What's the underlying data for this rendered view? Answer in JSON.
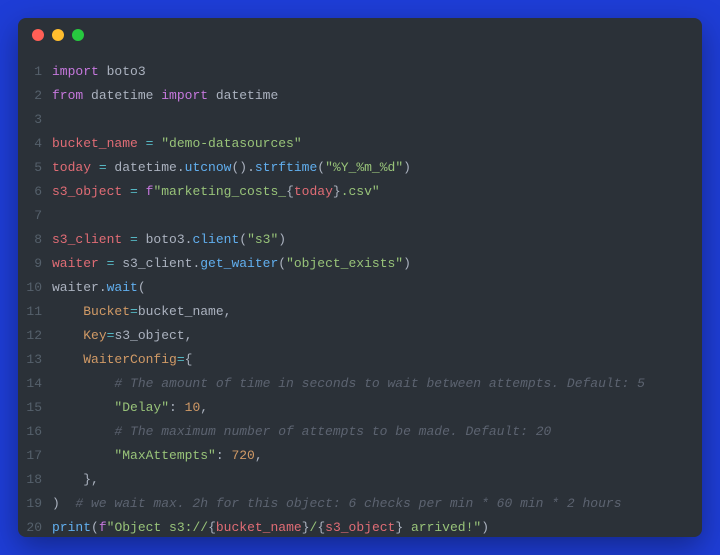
{
  "titlebar": {
    "dots": [
      "red",
      "yellow",
      "green"
    ]
  },
  "colors": {
    "background": "#1e3dd6",
    "editor_bg": "#2b3138",
    "gutter": "#55606b",
    "keyword": "#c678dd",
    "ident": "#e06c75",
    "func": "#61afef",
    "string": "#98c379",
    "number": "#d19a66",
    "operator": "#56b6c2",
    "default": "#abb2bf",
    "comment": "#5c6370"
  },
  "code": {
    "lines": [
      {
        "n": 1,
        "tokens": [
          {
            "t": "import ",
            "c": "kw"
          },
          {
            "t": "boto3",
            "c": "default"
          }
        ]
      },
      {
        "n": 2,
        "tokens": [
          {
            "t": "from ",
            "c": "kw"
          },
          {
            "t": "datetime ",
            "c": "default"
          },
          {
            "t": "import ",
            "c": "kw"
          },
          {
            "t": "datetime",
            "c": "default"
          }
        ]
      },
      {
        "n": 3,
        "tokens": []
      },
      {
        "n": 4,
        "tokens": [
          {
            "t": "bucket_name ",
            "c": "id"
          },
          {
            "t": "= ",
            "c": "op"
          },
          {
            "t": "\"demo-datasources\"",
            "c": "str"
          }
        ]
      },
      {
        "n": 5,
        "tokens": [
          {
            "t": "today ",
            "c": "id"
          },
          {
            "t": "= ",
            "c": "op"
          },
          {
            "t": "datetime",
            "c": "default"
          },
          {
            "t": ".",
            "c": "punc"
          },
          {
            "t": "utcnow",
            "c": "fn"
          },
          {
            "t": "().",
            "c": "punc"
          },
          {
            "t": "strftime",
            "c": "fn"
          },
          {
            "t": "(",
            "c": "punc"
          },
          {
            "t": "\"%Y_%m_%d\"",
            "c": "str"
          },
          {
            "t": ")",
            "c": "punc"
          }
        ]
      },
      {
        "n": 6,
        "tokens": [
          {
            "t": "s3_object ",
            "c": "id"
          },
          {
            "t": "= ",
            "c": "op"
          },
          {
            "t": "f",
            "c": "kw"
          },
          {
            "t": "\"marketing_costs_",
            "c": "str"
          },
          {
            "t": "{",
            "c": "punc"
          },
          {
            "t": "today",
            "c": "id"
          },
          {
            "t": "}",
            "c": "punc"
          },
          {
            "t": ".csv\"",
            "c": "str"
          }
        ]
      },
      {
        "n": 7,
        "tokens": []
      },
      {
        "n": 8,
        "tokens": [
          {
            "t": "s3_client ",
            "c": "id"
          },
          {
            "t": "= ",
            "c": "op"
          },
          {
            "t": "boto3",
            "c": "default"
          },
          {
            "t": ".",
            "c": "punc"
          },
          {
            "t": "client",
            "c": "fn"
          },
          {
            "t": "(",
            "c": "punc"
          },
          {
            "t": "\"s3\"",
            "c": "str"
          },
          {
            "t": ")",
            "c": "punc"
          }
        ]
      },
      {
        "n": 9,
        "tokens": [
          {
            "t": "waiter ",
            "c": "id"
          },
          {
            "t": "= ",
            "c": "op"
          },
          {
            "t": "s3_client",
            "c": "default"
          },
          {
            "t": ".",
            "c": "punc"
          },
          {
            "t": "get_waiter",
            "c": "fn"
          },
          {
            "t": "(",
            "c": "punc"
          },
          {
            "t": "\"object_exists\"",
            "c": "str"
          },
          {
            "t": ")",
            "c": "punc"
          }
        ]
      },
      {
        "n": 10,
        "tokens": [
          {
            "t": "waiter",
            "c": "default"
          },
          {
            "t": ".",
            "c": "punc"
          },
          {
            "t": "wait",
            "c": "fn"
          },
          {
            "t": "(",
            "c": "punc"
          }
        ]
      },
      {
        "n": 11,
        "tokens": [
          {
            "t": "    ",
            "c": "default"
          },
          {
            "t": "Bucket",
            "c": "prop"
          },
          {
            "t": "=",
            "c": "op"
          },
          {
            "t": "bucket_name",
            "c": "default"
          },
          {
            "t": ",",
            "c": "punc"
          }
        ]
      },
      {
        "n": 12,
        "tokens": [
          {
            "t": "    ",
            "c": "default"
          },
          {
            "t": "Key",
            "c": "prop"
          },
          {
            "t": "=",
            "c": "op"
          },
          {
            "t": "s3_object",
            "c": "default"
          },
          {
            "t": ",",
            "c": "punc"
          }
        ]
      },
      {
        "n": 13,
        "tokens": [
          {
            "t": "    ",
            "c": "default"
          },
          {
            "t": "WaiterConfig",
            "c": "prop"
          },
          {
            "t": "=",
            "c": "op"
          },
          {
            "t": "{",
            "c": "punc"
          }
        ]
      },
      {
        "n": 14,
        "tokens": [
          {
            "t": "        ",
            "c": "default"
          },
          {
            "t": "# The amount of time in seconds to wait between attempts. Default: 5",
            "c": "comment"
          }
        ]
      },
      {
        "n": 15,
        "tokens": [
          {
            "t": "        ",
            "c": "default"
          },
          {
            "t": "\"Delay\"",
            "c": "str"
          },
          {
            "t": ": ",
            "c": "punc"
          },
          {
            "t": "10",
            "c": "num"
          },
          {
            "t": ",",
            "c": "punc"
          }
        ]
      },
      {
        "n": 16,
        "tokens": [
          {
            "t": "        ",
            "c": "default"
          },
          {
            "t": "# The maximum number of attempts to be made. Default: 20",
            "c": "comment"
          }
        ]
      },
      {
        "n": 17,
        "tokens": [
          {
            "t": "        ",
            "c": "default"
          },
          {
            "t": "\"MaxAttempts\"",
            "c": "str"
          },
          {
            "t": ": ",
            "c": "punc"
          },
          {
            "t": "720",
            "c": "num"
          },
          {
            "t": ",",
            "c": "punc"
          }
        ]
      },
      {
        "n": 18,
        "tokens": [
          {
            "t": "    },",
            "c": "punc"
          }
        ]
      },
      {
        "n": 19,
        "tokens": [
          {
            "t": ")  ",
            "c": "punc"
          },
          {
            "t": "# we wait max. 2h for this object: 6 checks per min * 60 min * 2 hours",
            "c": "comment"
          }
        ]
      },
      {
        "n": 20,
        "tokens": [
          {
            "t": "print",
            "c": "fn"
          },
          {
            "t": "(",
            "c": "punc"
          },
          {
            "t": "f",
            "c": "kw"
          },
          {
            "t": "\"Object s3://",
            "c": "str"
          },
          {
            "t": "{",
            "c": "punc"
          },
          {
            "t": "bucket_name",
            "c": "id"
          },
          {
            "t": "}",
            "c": "punc"
          },
          {
            "t": "/",
            "c": "str"
          },
          {
            "t": "{",
            "c": "punc"
          },
          {
            "t": "s3_object",
            "c": "id"
          },
          {
            "t": "}",
            "c": "punc"
          },
          {
            "t": " arrived!\"",
            "c": "str"
          },
          {
            "t": ")",
            "c": "punc"
          }
        ]
      }
    ]
  }
}
